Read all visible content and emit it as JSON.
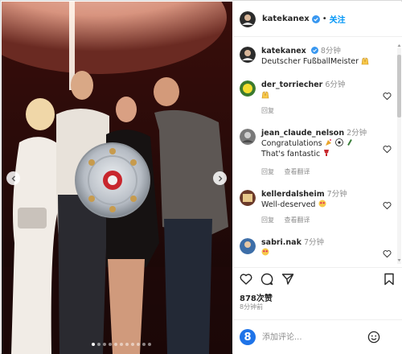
{
  "post": {
    "author": "katekanex",
    "follow_label": "关注",
    "separator": "•"
  },
  "caption": {
    "author": "katekanex",
    "time": "8分钟",
    "text": "Deutscher FußballMeister"
  },
  "comments": [
    {
      "user": "der_torriecher",
      "time": "6分钟",
      "text": "",
      "reply": "回复",
      "translate": ""
    },
    {
      "user": "jean_claude_nelson",
      "time": "2分钟",
      "text": "Congratulations",
      "text2": "That's fantastic",
      "reply": "回复",
      "translate": "查看翻译"
    },
    {
      "user": "kellerdalsheim",
      "time": "7分钟",
      "text": "Well-deserved",
      "reply": "回复",
      "translate": "查看翻译"
    },
    {
      "user": "sabri.nak",
      "time": "7分钟",
      "text": "",
      "reply": "",
      "translate": ""
    }
  ],
  "stats": {
    "views": "878次赞",
    "ago": "8分钟前"
  },
  "add_comment": {
    "placeholder": "添加评论..."
  },
  "icons": {
    "like": "heart-icon",
    "comment": "comment-icon",
    "share": "share-icon",
    "save": "bookmark-icon"
  },
  "colors": {
    "link": "#0095f6",
    "verified": "#3897f0",
    "muted": "#8e8e8e"
  }
}
